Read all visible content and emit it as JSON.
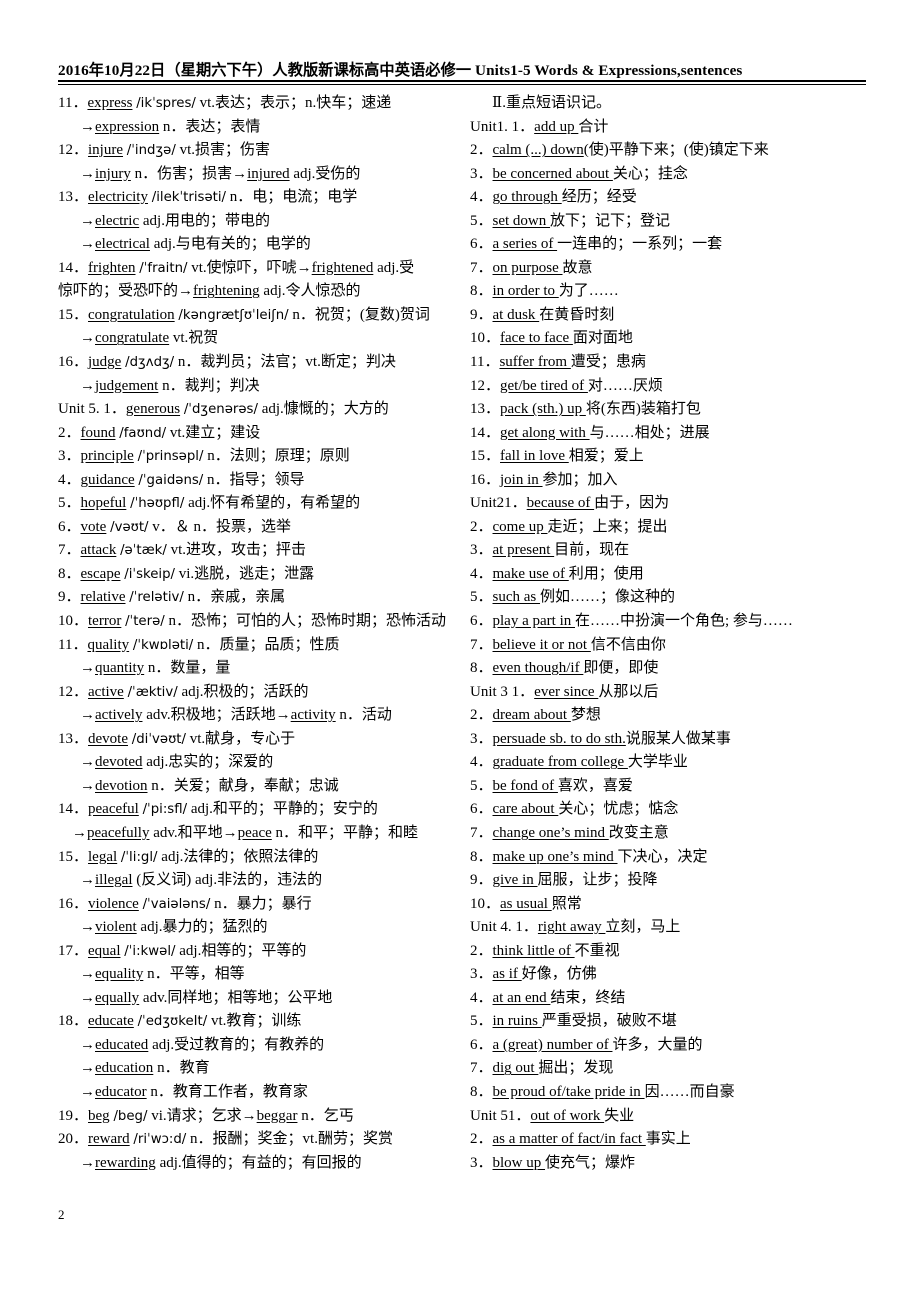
{
  "document": {
    "header_title": "2016年10月22日（星期六下午）人教版新课标高中英语必修一 Units1-5 Words & Expressions,sentences",
    "page_number": "2"
  },
  "left_column": {
    "entries": [
      {
        "num": "11．",
        "indent": "none",
        "text": "express /ikˈspres/ vt.表达；表示；n.快车；速递",
        "head": "express"
      },
      {
        "num": "",
        "indent": "arrow",
        "text": "→expression n．表达；表情",
        "head": "expression"
      },
      {
        "num": "12．",
        "indent": "none",
        "text": "injure /ˈindʒə/ vt.损害；伤害",
        "head": "injure"
      },
      {
        "num": "",
        "indent": "arrow",
        "text": "→injury n．伤害；损害→injured adj.受伤的",
        "head": "injury"
      },
      {
        "num": "13．",
        "indent": "none",
        "text": "electricity /ilekˈtrisəti/ n．电；电流；电学",
        "head": "electricity"
      },
      {
        "num": "",
        "indent": "arrow",
        "text": "→electric adj.用电的；带电的",
        "head": "electric"
      },
      {
        "num": "",
        "indent": "arrow",
        "text": "→electrical adj.与电有关的；电学的",
        "head": "electrical"
      },
      {
        "num": "14．",
        "indent": "none",
        "text": "frighten /ˈfraitn/ vt.使惊吓，吓唬→frightened adj.受",
        "head": "frighten"
      },
      {
        "num": "",
        "indent": "wrap",
        "text": "惊吓的；受恐吓的→frightening adj.令人惊恐的",
        "head": "frightening"
      },
      {
        "num": "15．",
        "indent": "none",
        "text": "congratulation /kəngrætʃʊˈleiʃn/ n．祝贺；(复数)贺词",
        "head": "congratulation"
      },
      {
        "num": "",
        "indent": "arrow",
        "text": "→congratulate vt.祝贺",
        "head": "congratulate"
      },
      {
        "num": "16．",
        "indent": "none",
        "text": "judge /dʒʌdʒ/ n．裁判员；法官；vt.断定；判决",
        "head": "judge"
      },
      {
        "num": "",
        "indent": "arrow",
        "text": "→judgement n．裁判；判决",
        "head": "judgement"
      },
      {
        "num": "Unit 5.",
        "indent": "none",
        "text": "Unit 5. 1．generous /ˈdʒenərəs/ adj.慷慨的；大方的",
        "head": "generous"
      },
      {
        "num": "2．",
        "indent": "none",
        "text": "found /faʊnd/ vt.建立；建设",
        "head": "found"
      },
      {
        "num": "3．",
        "indent": "none",
        "text": "principle /ˈprinsəpl/ n．法则；原理；原则",
        "head": "principle"
      },
      {
        "num": "4．",
        "indent": "none",
        "text": "guidance /ˈgaidəns/ n．指导；领导",
        "head": "guidance"
      },
      {
        "num": "5．",
        "indent": "none",
        "text": "hopeful /ˈhəʊpfl/ adj.怀有希望的，有希望的",
        "head": "hopeful"
      },
      {
        "num": "6．",
        "indent": "none",
        "text": "vote /vəʊt/ v．＆ n．投票，选举",
        "head": "vote"
      },
      {
        "num": "7．",
        "indent": "none",
        "text": "attack /əˈtæk/ vt.进攻，攻击；抨击",
        "head": "attack"
      },
      {
        "num": "8．",
        "indent": "none",
        "text": "escape /iˈskeip/ vi.逃脱，逃走；泄露",
        "head": "escape"
      },
      {
        "num": "9．",
        "indent": "none",
        "text": "relative /ˈrelətiv/ n．亲戚，亲属",
        "head": "relative"
      },
      {
        "num": "10．",
        "indent": "none",
        "text": "terror /ˈterə/ n．恐怖；可怕的人；恐怖时期；恐怖活动",
        "head": "terror"
      },
      {
        "num": "11．",
        "indent": "none",
        "text": "quality /ˈkwɒləti/ n．质量；品质；性质",
        "head": "quality"
      },
      {
        "num": "",
        "indent": "arrow",
        "text": "→quantity n．数量，量",
        "head": "quantity"
      },
      {
        "num": "12．",
        "indent": "none",
        "text": "active /ˈæktiv/ adj.积极的；活跃的",
        "head": "active"
      },
      {
        "num": "",
        "indent": "arrow",
        "text": "→actively adv.积极地；活跃地→activity n．活动",
        "head": "actively"
      },
      {
        "num": "13．",
        "indent": "none",
        "text": "devote /diˈvəʊt/ vt.献身，专心于",
        "head": "devote"
      },
      {
        "num": "",
        "indent": "arrow",
        "text": "→devoted adj.忠实的；深爱的",
        "head": "devoted"
      },
      {
        "num": "",
        "indent": "arrow",
        "text": "→devotion n．关爱；献身，奉献；忠诚",
        "head": "devotion"
      },
      {
        "num": "14．",
        "indent": "none",
        "text": "peaceful /ˈpi:sfl/ adj.和平的；平静的；安宁的",
        "head": "peaceful"
      },
      {
        "num": "",
        "indent": "wrap2",
        "text": "→peacefully adv.和平地→peace n．和平；平静；和睦",
        "head": "peacefully"
      },
      {
        "num": "15．",
        "indent": "none",
        "text": "legal /ˈli:gl/ adj.法律的；依照法律的",
        "head": "legal"
      },
      {
        "num": "",
        "indent": "arrow",
        "text": "→illegal (反义词) adj.非法的，违法的",
        "head": "illegal"
      },
      {
        "num": "16．",
        "indent": "none",
        "text": "violence /ˈvaiələns/ n．暴力；暴行",
        "head": "violence"
      },
      {
        "num": "",
        "indent": "arrow",
        "text": "→violent adj.暴力的；猛烈的",
        "head": "violent"
      },
      {
        "num": "17．",
        "indent": "none",
        "text": "equal /ˈi:kwəl/ adj.相等的；平等的",
        "head": "equal"
      },
      {
        "num": "",
        "indent": "arrow",
        "text": "→equality n．平等，相等",
        "head": "equality"
      },
      {
        "num": "",
        "indent": "arrow",
        "text": "→equally adv.同样地；相等地；公平地",
        "head": "equally"
      },
      {
        "num": "18．",
        "indent": "none",
        "text": "educate /ˈedʒʊkeIt/ vt.教育；训练",
        "head": "educate"
      },
      {
        "num": "",
        "indent": "arrow",
        "text": "→educated adj.受过教育的；有教养的",
        "head": "educated"
      },
      {
        "num": "",
        "indent": "arrow",
        "text": "→education n．教育",
        "head": "education"
      },
      {
        "num": "",
        "indent": "arrow",
        "text": "→educator n．教育工作者，教育家",
        "head": "educator"
      },
      {
        "num": "19．",
        "indent": "none",
        "text": "beg /beg/ vi.请求；乞求→beggar n．乞丐",
        "head": "beg"
      },
      {
        "num": "20．",
        "indent": "none",
        "text": "reward /riˈwɔ:d/ n．报酬；奖金；vt.酬劳；奖赏",
        "head": "reward"
      },
      {
        "num": "",
        "indent": "arrow",
        "text": "→rewarding adj.值得的；有益的；有回报的",
        "head": "rewarding"
      }
    ]
  },
  "right_column": {
    "section_heading": "Ⅱ.重点短语识记。",
    "entries": [
      {
        "num": "",
        "text": "Unit1. 1．add up 合计",
        "head": "add up"
      },
      {
        "num": "2．",
        "text": "calm (...) down(使)平静下来；(使)镇定下来",
        "head": "calm (...) down"
      },
      {
        "num": "3．",
        "text": "be concerned about 关心；挂念",
        "head": "be concerned about"
      },
      {
        "num": "4．",
        "text": "go through 经历；经受",
        "head": "go through"
      },
      {
        "num": "5．",
        "text": "set down 放下；记下；登记",
        "head": "set down"
      },
      {
        "num": "6．",
        "text": "a series of 一连串的；一系列；一套",
        "head": "a series of"
      },
      {
        "num": "7．",
        "text": "on purpose 故意",
        "head": "on purpose"
      },
      {
        "num": "8．",
        "text": "in order to 为了……",
        "head": "in order to"
      },
      {
        "num": "9．",
        "text": "at dusk 在黄昏时刻",
        "head": "at dusk"
      },
      {
        "num": "10．",
        "text": "face to face 面对面地",
        "head": "face to face"
      },
      {
        "num": "11．",
        "text": "suffer from 遭受；患病",
        "head": "suffer from"
      },
      {
        "num": "12．",
        "text": "get/be tired of 对……厌烦",
        "head": "get/be tired of"
      },
      {
        "num": "13．",
        "text": "pack (sth.) up 将(东西)装箱打包",
        "head": "pack (sth.) up"
      },
      {
        "num": "14．",
        "text": "get along with 与……相处；进展",
        "head": "get along with"
      },
      {
        "num": "15．",
        "text": "fall in love 相爱；爱上",
        "head": "fall in love"
      },
      {
        "num": "16．",
        "text": "join in 参加；加入",
        "head": "join in"
      },
      {
        "num": "",
        "text": "Unit21．because of 由于，因为",
        "head": "because of"
      },
      {
        "num": "2．",
        "text": "come up 走近；上来；提出",
        "head": "come up"
      },
      {
        "num": "3．",
        "text": "at present 目前，现在",
        "head": "at present"
      },
      {
        "num": "4．",
        "text": "make use of 利用；使用",
        "head": "make use of"
      },
      {
        "num": "5．",
        "text": "such as 例如……；像这种的",
        "head": "such as"
      },
      {
        "num": "6．",
        "text": "play a part in 在……中扮演一个角色; 参与……",
        "head": "play a part in"
      },
      {
        "num": "7．",
        "text": "believe it or not 信不信由你",
        "head": "believe it or not"
      },
      {
        "num": "8．",
        "text": "even though/if 即便，即使",
        "head": "even though/if"
      },
      {
        "num": "",
        "text": "Unit 3 1．ever since 从那以后",
        "head": "ever since"
      },
      {
        "num": "2．",
        "text": "dream about 梦想",
        "head": "dream about"
      },
      {
        "num": "3．",
        "text": "persuade sb. to do sth.说服某人做某事",
        "head": "persuade sb. to do sth."
      },
      {
        "num": "4．",
        "text": "graduate from college 大学毕业",
        "head": "graduate from college"
      },
      {
        "num": "5．",
        "text": "be fond of 喜欢，喜爱",
        "head": "be fond of"
      },
      {
        "num": "6．",
        "text": "care about 关心；忧虑；惦念",
        "head": "care about"
      },
      {
        "num": "7．",
        "text": "change one's mind 改变主意",
        "head": "change one's mind"
      },
      {
        "num": "8．",
        "text": "make up one's mind 下决心，决定",
        "head": "make up one's mind"
      },
      {
        "num": "9．",
        "text": "give in 屈服，让步；投降",
        "head": "give in"
      },
      {
        "num": "10．",
        "text": "as usual 照常",
        "head": "as usual"
      },
      {
        "num": "",
        "text": "Unit 4. 1．right away 立刻，马上",
        "head": "right away"
      },
      {
        "num": "2．",
        "text": "think little of 不重视",
        "head": "think little of"
      },
      {
        "num": "3．",
        "text": "as if 好像，仿佛",
        "head": "as if"
      },
      {
        "num": "4．",
        "text": "at an end 结束，终结",
        "head": "at an end"
      },
      {
        "num": "5．",
        "text": "in ruins 严重受损，破败不堪",
        "head": "in ruins"
      },
      {
        "num": "6．",
        "text": "a (great) number of 许多，大量的",
        "head": "a (great) number of"
      },
      {
        "num": "7．",
        "text": "dig out 掘出；发现",
        "head": "dig out"
      },
      {
        "num": "8．",
        "text": "be proud of/take pride in 因……而自豪",
        "head": "be proud of/take pride in"
      },
      {
        "num": "",
        "text": "Unit 51．out of work 失业",
        "head": "out of work"
      },
      {
        "num": "2．",
        "text": "as a matter of fact/in fact 事实上",
        "head": "as a matter of fact/in fact"
      },
      {
        "num": "3．",
        "text": "blow up 使充气；爆炸",
        "head": "blow up"
      }
    ]
  },
  "lines": {
    "left": [
      "11．<u>express</u> <i>/ikˈspres/</i> vt.表达；表示；n.快车；速递",
      "→<u>expression</u> n．表达；表情",
      "12．<u>injure</u> <i>/ˈindʒə/</i> vt.损害；伤害",
      "→<u>injury</u> n．伤害；损害→<u>injured</u> adj.受伤的",
      "13．<u>electricity</u> <i>/ilekˈtrisəti/</i> n．电；电流；电学",
      "→<u>electric</u> adj.用电的；带电的",
      "→<u>electrical</u> adj.与电有关的；电学的",
      "14．<u>frighten</u> <i>/ˈfraitn/</i> vt.使惊吓，吓唬→<u>frightened</u> adj.受",
      "惊吓的；受恐吓的→<u>frightening</u> adj.令人惊恐的",
      "15．<u>congratulation</u> <i>/kəngrætʃʊˈleiʃn/</i> n．祝贺；(复数)贺词",
      "→<u>congratulate</u> vt.祝贺",
      "16．<u>judge</u> <i>/dʒʌdʒ/</i> n．裁判员；法官；vt.断定；判决",
      "→<u>judgement</u> n．裁判；判决",
      "Unit 5. 1．<u>generous</u> <i>/ˈdʒenərəs/</i> adj.慷慨的；大方的",
      "2．<u>found</u> <i>/faʊnd/</i> vt.建立；建设",
      "3．<u>principle</u> <i>/ˈprinsəpl/</i> n．法则；原理；原则",
      "4．<u>guidance</u> <i>/ˈgaidəns/</i> n．指导；领导",
      "5．<u>hopeful</u> <i>/ˈhəʊpfl/</i> adj.怀有希望的，有希望的",
      "6．<u>vote</u> <i>/vəʊt/</i> v．＆ n．投票，选举",
      "7．<u>attack</u> <i>/əˈtæk/</i> vt.进攻，攻击；抨击",
      "8．<u>escape</u> <i>/iˈskeip/</i> vi.逃脱，逃走；泄露",
      "9．<u>relative</u> <i>/ˈrelətiv/</i> n．亲戚，亲属",
      "10．<u>terror</u> <i>/ˈterə/</i> n．恐怖；可怕的人；恐怖时期；恐怖活动",
      "11．<u>quality</u> <i>/ˈkwɒləti/</i> n．质量；品质；性质",
      "→<u>quantity</u> n．数量，量",
      "12．<u>active</u> <i>/ˈæktiv/</i> adj.积极的；活跃的",
      "→<u>actively</u> adv.积极地；活跃地→<u>activity</u> n．活动",
      "13．<u>devote</u> <i>/diˈvəʊt/</i> vt.献身，专心于",
      "→<u>devoted</u> adj.忠实的；深爱的",
      "→<u>devotion</u> n．关爱；献身，奉献；忠诚",
      "14．<u>peaceful</u> <i>/ˈpi:sfl/</i> adj.和平的；平静的；安宁的",
      "→<u>peacefully</u> adv.和平地→<u>peace</u> n．和平；平静；和睦",
      "15．<u>legal</u> <i>/ˈli:gl/</i> adj.法律的；依照法律的",
      "→<u>illegal</u> (反义词) adj.非法的，违法的",
      "16．<u>violence</u> <i>/ˈvaiələns/</i> n．暴力；暴行",
      "→<u>violent</u> adj.暴力的；猛烈的",
      "17．<u>equal</u> <i>/ˈi:kwəl/</i> adj.相等的；平等的",
      "→<u>equality</u> n．平等，相等",
      "→<u>equally</u> adv.同样地；相等地；公平地",
      "18．<u>educate</u> <i>/ˈedʒʊkeIt/</i> vt.教育；训练",
      "→<u>educated</u> adj.受过教育的；有教养的",
      "→<u>education</u> n．教育",
      "→<u>educator</u> n．教育工作者，教育家",
      "19．<u>beg</u> <i>/beg/</i> vi.请求；乞求→<u>beggar</u> n．乞丐",
      "20．<u>reward</u> <i>/riˈwɔ:d/</i> n．报酬；奖金；vt.酬劳；奖赏",
      "→<u>rewarding</u> adj.值得的；有益的；有回报的"
    ],
    "right": [
      "Ⅱ.重点短语识记。",
      "Unit1. 1．<u>add up </u>合计",
      "2．<u>calm (...) down</u>(使)平静下来；(使)镇定下来",
      "3．<u>be concerned about </u>关心；挂念",
      "4．<u>go through </u>经历；经受",
      "5．<u>set down </u>放下；记下；登记",
      "6．<u>a series of </u>一连串的；一系列；一套",
      "7．<u>on purpose </u>故意",
      "8．<u>in order to </u>为了……",
      "9．<u>at dusk </u>在黄昏时刻",
      "10．<u>face to face </u>面对面地",
      "11．<u>suffer from </u>遭受；患病",
      "12．<u>get/be tired of </u>对……厌烦",
      "13．<u>pack (sth.) up </u>将(东西)装箱打包",
      "14．<u>get along with </u>与……相处；进展",
      "15．<u>fall in love </u>相爱；爱上",
      "16．<u>join in </u>参加；加入",
      "Unit21．<u>because of </u>由于，因为",
      "2．<u>come up </u>走近；上来；提出",
      "3．<u>at present </u>目前，现在",
      "4．<u>make use of </u>利用；使用",
      "5．<u>such as </u>例如……；像这种的",
      "6．<u>play a part in </u>在……中扮演一个角色; 参与……",
      "7．<u>believe it or not </u>信不信由你",
      "8．<u>even though/if </u>即便，即使",
      "Unit 3 1．<u>ever since </u>从那以后",
      "2．<u>dream about </u>梦想",
      "3．<u>persuade sb. to do sth.</u>说服某人做某事",
      "4．<u>graduate from college </u>大学毕业",
      "5．<u>be fond of </u>喜欢，喜爱",
      "6．<u>care about </u>关心；忧虑；惦念",
      "7．<u>change one’s mind </u>改变主意",
      "8．<u>make up one’s mind </u>下决心，决定",
      "9．<u>give in </u>屈服，让步；投降",
      "10．<u>as usual </u>照常",
      "Unit 4. 1．<u>right away </u>立刻，马上",
      "2．<u>think little of </u>不重视",
      "3．<u>as if </u>好像，仿佛",
      "4．<u>at an end </u>结束，终结",
      "5．<u>in ruins </u>严重受损，破败不堪",
      "6．<u>a (great) number of </u>许多，大量的",
      "7．<u>dig out </u>掘出；发现",
      "8．<u>be proud of/take pride in </u>因……而自豪",
      "Unit 51．<u>out of work </u>失业",
      "2．<u>as a matter of fact/in fact </u>事实上",
      "3．<u>blow up </u>使充气；爆炸"
    ]
  },
  "layout": {
    "left_indent_flags": [
      0,
      1,
      0,
      1,
      0,
      1,
      1,
      0,
      2,
      0,
      1,
      0,
      1,
      0,
      0,
      0,
      0,
      0,
      0,
      0,
      0,
      0,
      0,
      0,
      1,
      0,
      1,
      0,
      1,
      1,
      0,
      3,
      0,
      1,
      0,
      1,
      0,
      1,
      1,
      0,
      1,
      1,
      1,
      0,
      0,
      1
    ],
    "right_indent_flags": [
      4,
      0,
      0,
      0,
      0,
      0,
      0,
      0,
      0,
      0,
      0,
      0,
      0,
      0,
      0,
      0,
      0,
      0,
      0,
      0,
      0,
      0,
      0,
      0,
      0,
      0,
      0,
      0,
      0,
      0,
      0,
      0,
      0,
      0,
      0,
      0,
      0,
      0,
      0,
      0,
      0,
      0,
      0,
      0,
      0,
      0,
      0
    ]
  }
}
